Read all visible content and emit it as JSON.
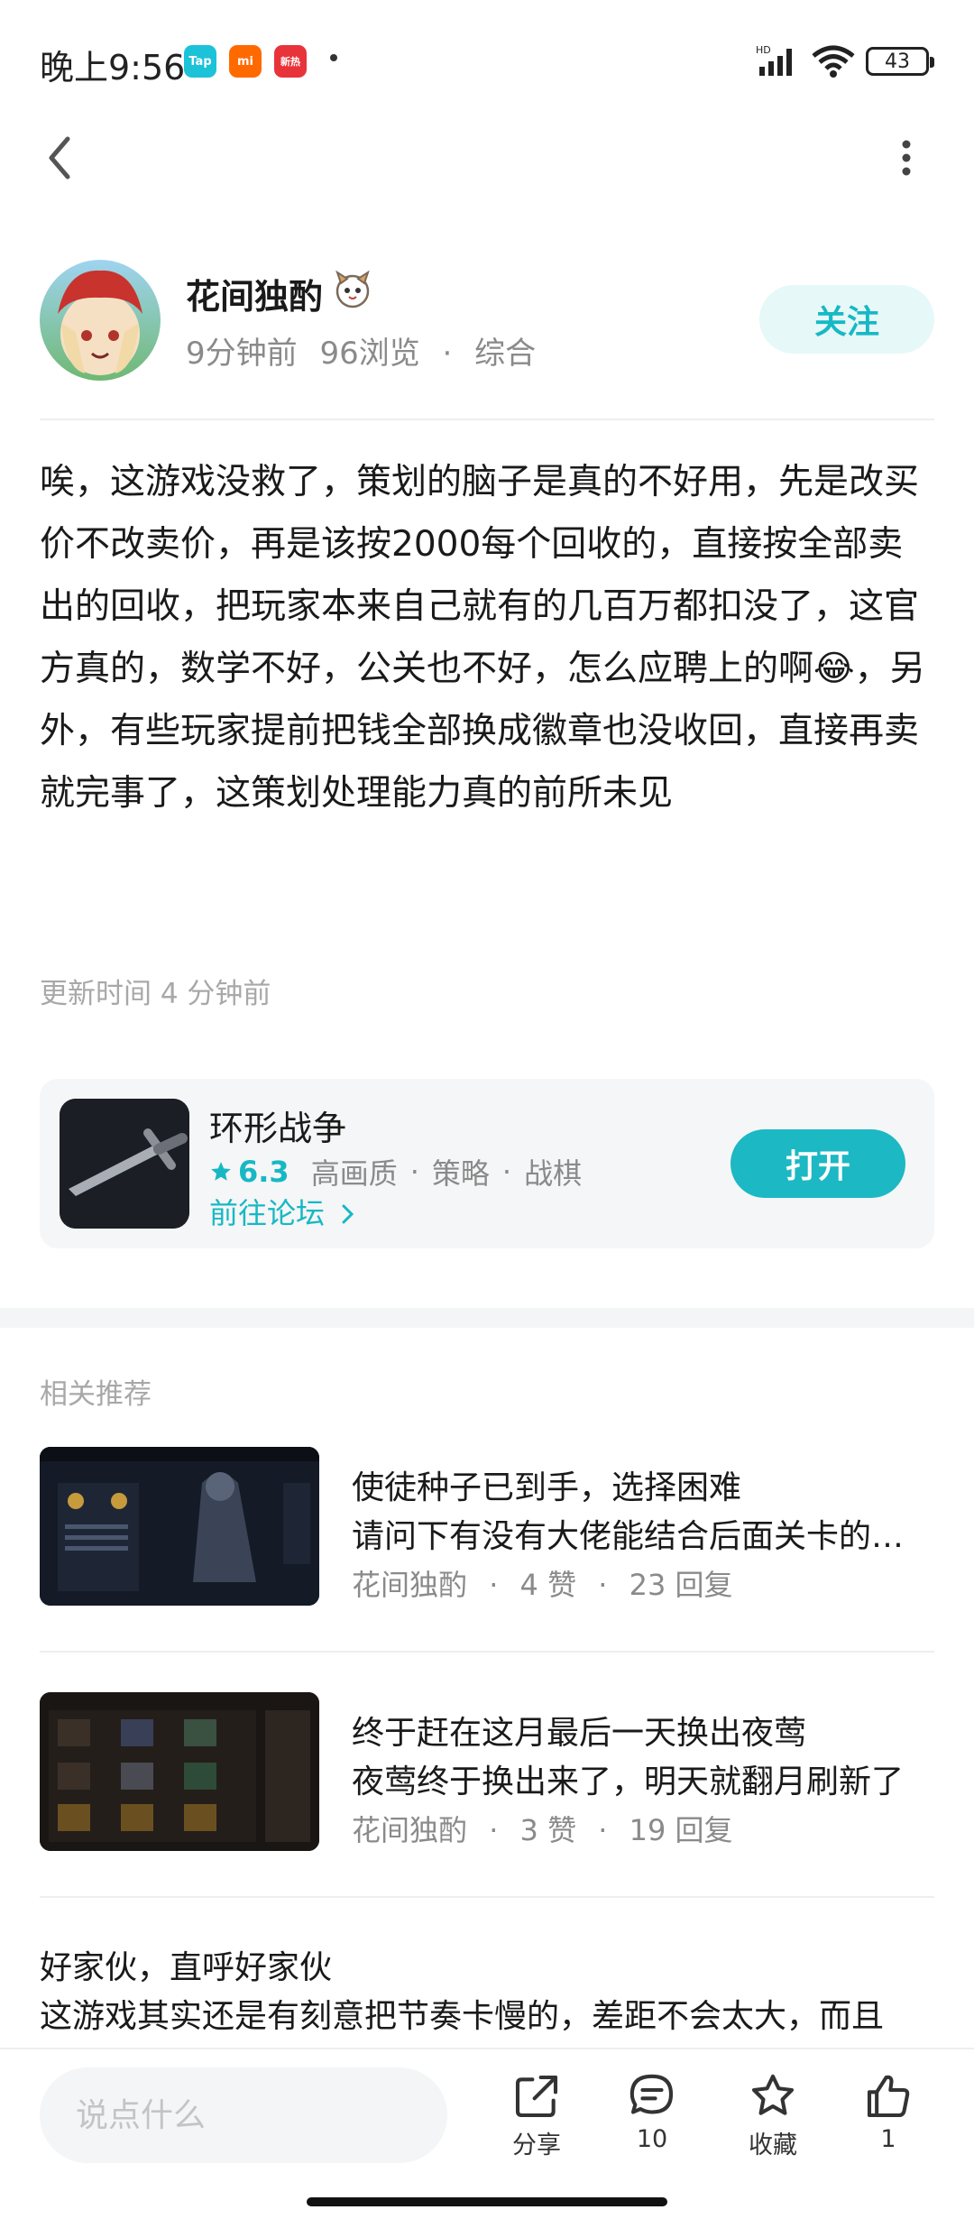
{
  "status_bar": {
    "time": "晚上9:56",
    "app_badges": [
      "Tap",
      "mi",
      "新热"
    ],
    "battery": "43"
  },
  "header": {
    "back_icon": "chevron-left-icon",
    "more_icon": "more-vertical-icon"
  },
  "author": {
    "name": "花间独酌",
    "time_ago": "9分钟前",
    "views": "96浏览",
    "category": "综合",
    "follow_label": "关注"
  },
  "post": {
    "body": "唉，这游戏没救了，策划的脑子是真的不好用，先是改买价不改卖价，再是该按2000每个回收的，直接按全部卖出的回收，把玩家本来自己就有的几百万都扣没了，这官方真的，数学不好，公关也不好，怎么应聘上的啊😂，另外，有些玩家提前把钱全部换成徽章也没收回，直接再卖就完事了，这策划处理能力真的前所未见",
    "update_time": "更新时间 4 分钟前"
  },
  "game": {
    "name": "环形战争",
    "rating": "6.3",
    "tags": [
      "高画质",
      "策略",
      "战棋"
    ],
    "forum_link": "前往论坛",
    "open_label": "打开"
  },
  "recommend": {
    "section_title": "相关推荐",
    "items": [
      {
        "title": "使徒种子已到手，选择困难",
        "snippet": "请问下有没有大佬能结合后面关卡的情况给点建议",
        "author": "花间独酌",
        "likes": "4 赞",
        "replies": "23 回复"
      },
      {
        "title": "终于赶在这月最后一天换出夜莺",
        "snippet": "夜莺终于换出来了，明天就翻月刷新了",
        "author": "花间独酌",
        "likes": "3 赞",
        "replies": "19 回复"
      },
      {
        "title": "好家伙，直呼好家伙",
        "snippet": "这游戏其实还是有刻意把节奏卡慢的，差距不会太大，而且"
      }
    ]
  },
  "bottom_bar": {
    "comment_placeholder": "说点什么",
    "share_label": "分享",
    "comment_count": "10",
    "favorite_label": "收藏",
    "like_count": "1"
  }
}
